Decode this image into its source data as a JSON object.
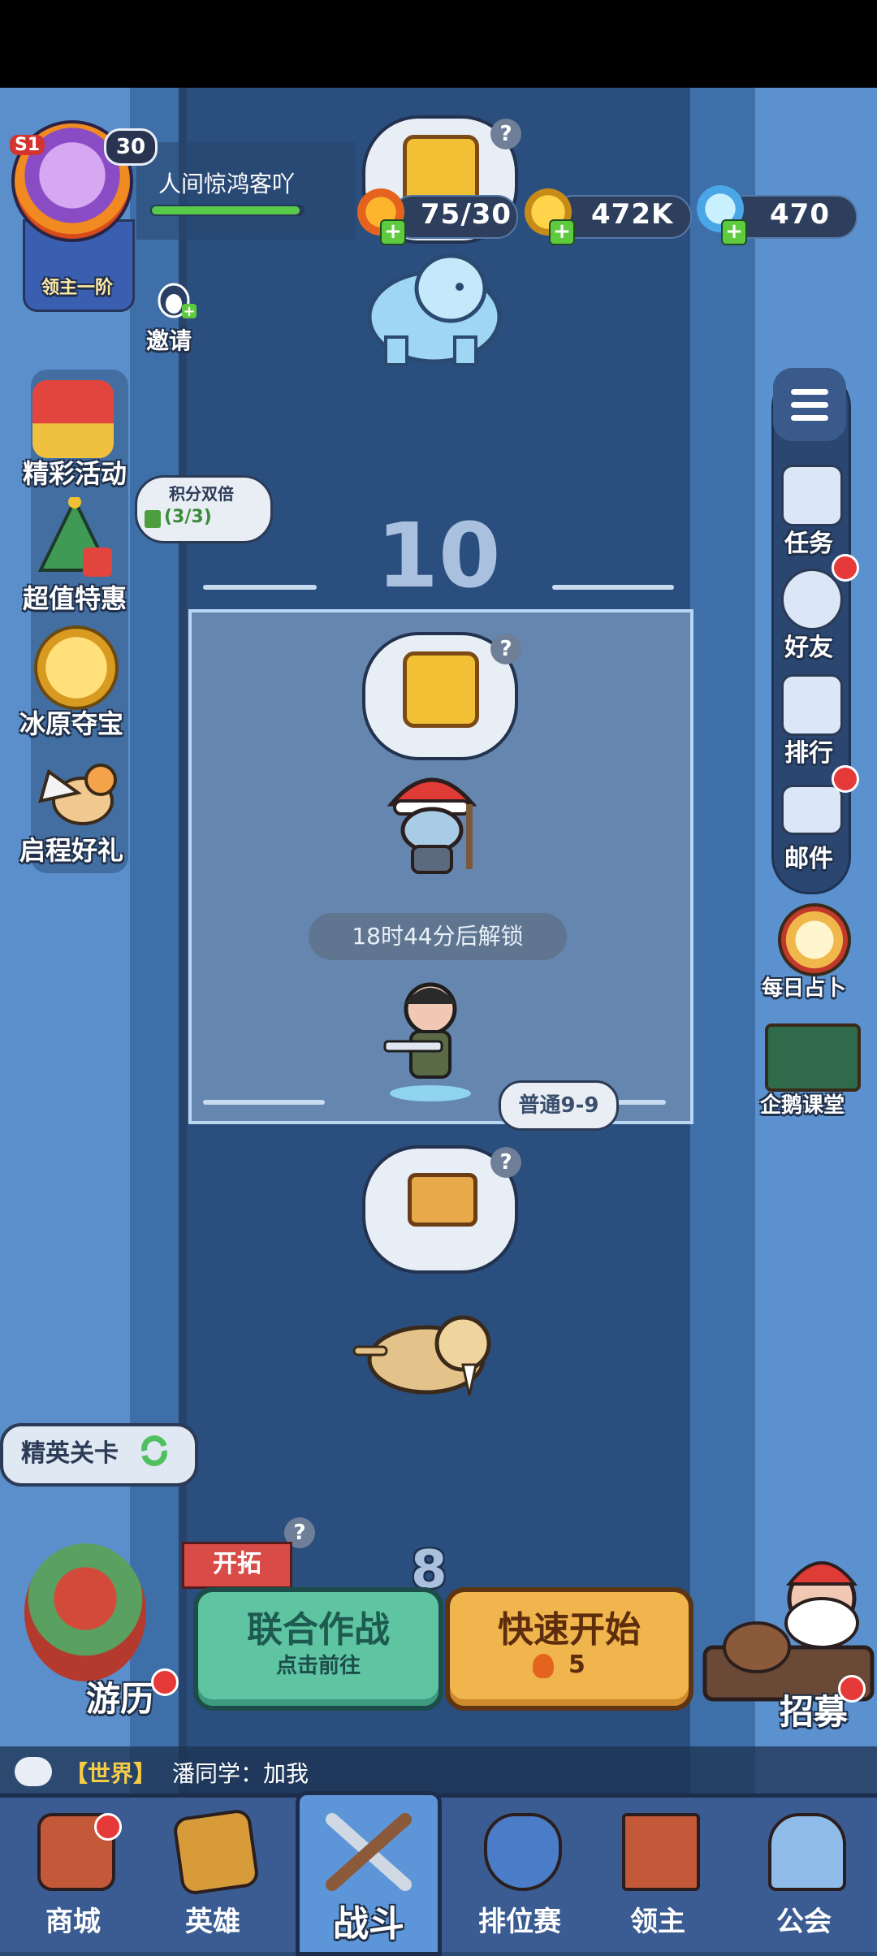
{
  "player": {
    "season": "S1",
    "level": "30",
    "name": "人间惊鸿客吖",
    "rank": "领主一阶",
    "exp_fraction": 0.98
  },
  "invite_label": "邀请",
  "resources": {
    "stamina": "75/30",
    "gold": "472K",
    "gems": "470"
  },
  "left_menu": [
    {
      "label": "精彩活动",
      "icon": "gift-icon"
    },
    {
      "label": "超值特惠",
      "icon": "christmas-tree-icon"
    },
    {
      "label": "冰原夺宝",
      "icon": "clover-coin-icon"
    },
    {
      "label": "启程好礼",
      "icon": "griffin-icon"
    }
  ],
  "bubble": {
    "title": "积分双倍",
    "count": "(3/3)"
  },
  "right_menu": [
    {
      "label": "任务",
      "icon": "clipboard-icon"
    },
    {
      "label": "好友",
      "icon": "friends-icon"
    },
    {
      "label": "排行",
      "icon": "podium-icon"
    },
    {
      "label": "邮件",
      "icon": "mail-icon"
    }
  ],
  "right_extras": [
    {
      "label": "每日占卜",
      "icon": "crystal-ball-icon"
    },
    {
      "label": "企鹅课堂",
      "icon": "penguin-icon"
    }
  ],
  "stage": {
    "number": "10",
    "lock_text": "18时44分后解锁",
    "current_tag": "普通9-9",
    "next_number": "8"
  },
  "actions": {
    "elite": "精英关卡",
    "pioneer": "开拓",
    "coop_title": "联合作战",
    "coop_sub": "点击前往",
    "quick_title": "快速开始",
    "quick_cost": "5",
    "travel": "游历",
    "recruit": "招募"
  },
  "chat": {
    "channel": "【世界】",
    "message": "潘同学：加我"
  },
  "nav": [
    {
      "label": "商城",
      "icon": "shop-icon"
    },
    {
      "label": "英雄",
      "icon": "hero-card-icon"
    },
    {
      "label": "战斗",
      "icon": "swords-icon"
    },
    {
      "label": "排位赛",
      "icon": "shield-icon"
    },
    {
      "label": "领主",
      "icon": "banner-icon"
    },
    {
      "label": "公会",
      "icon": "castle-icon"
    }
  ],
  "colors": {
    "accent_green": "#5ec4a2",
    "accent_orange": "#f0b54c",
    "badge_red": "#e63a3a"
  }
}
